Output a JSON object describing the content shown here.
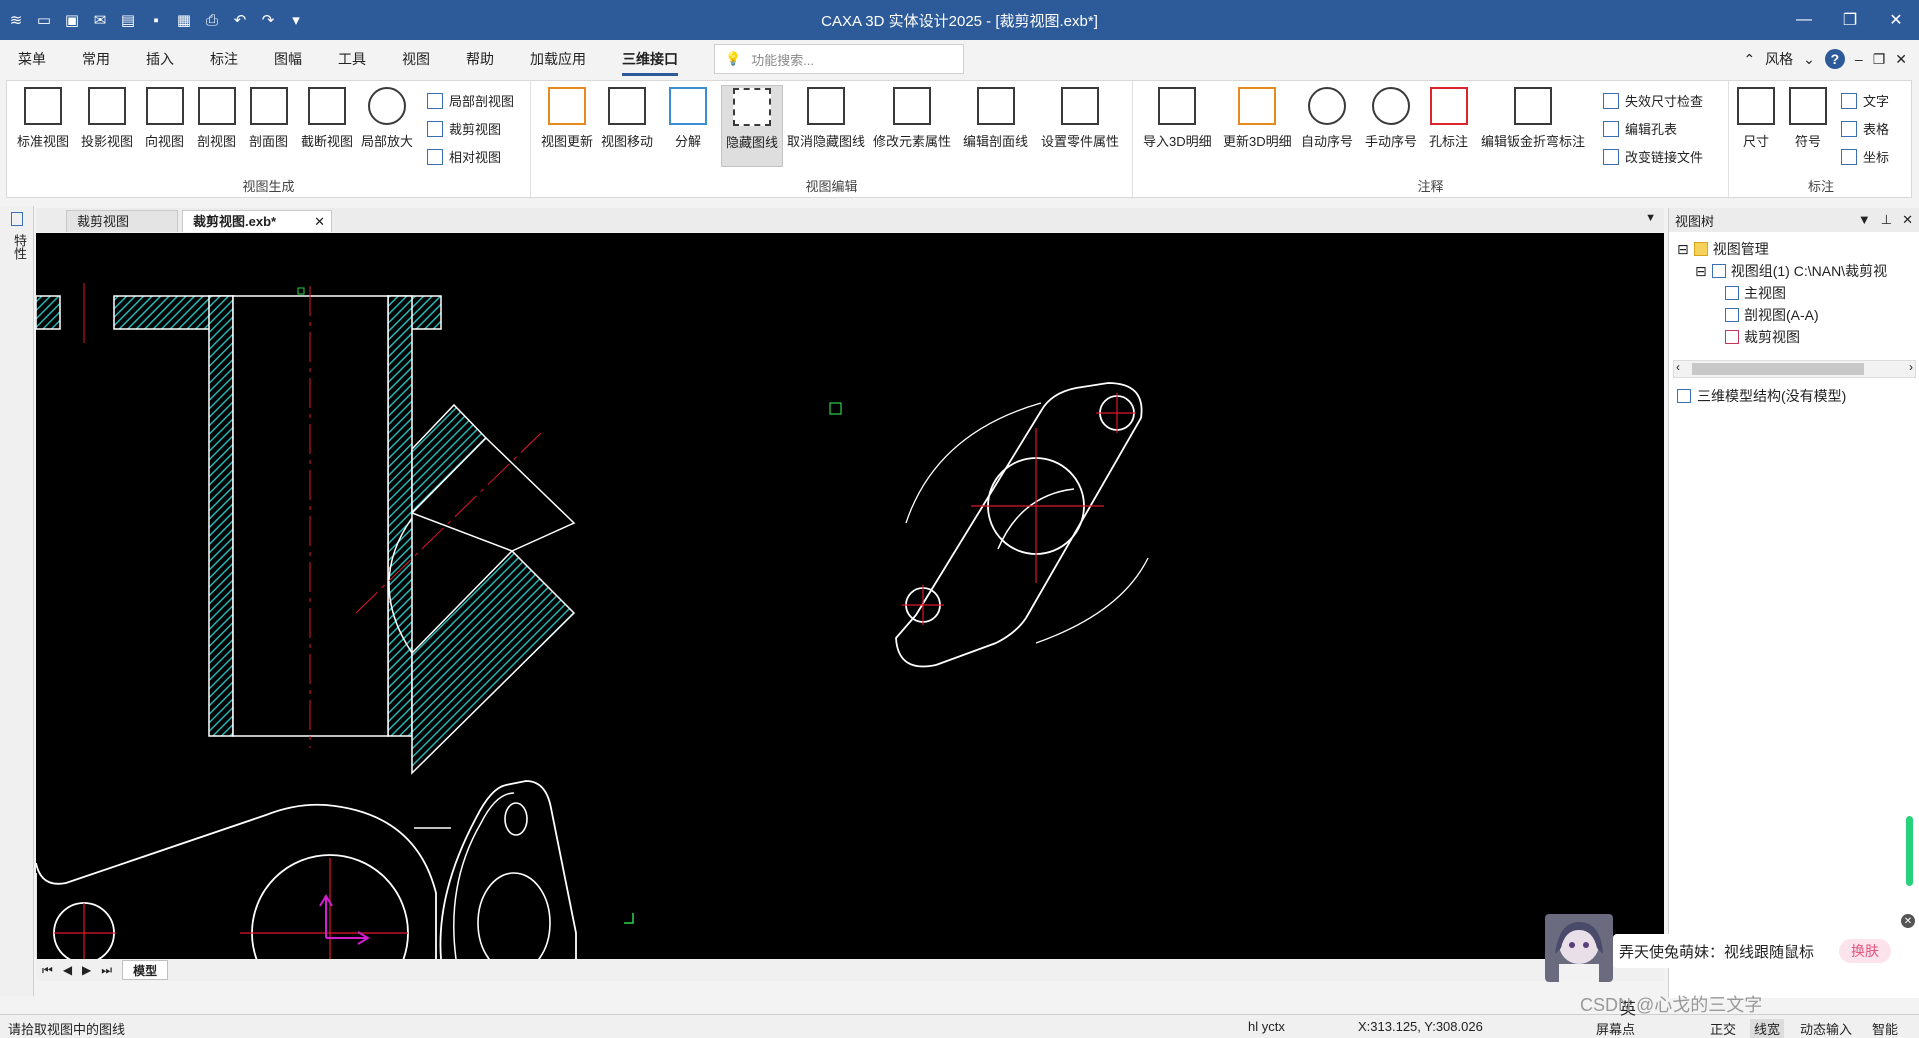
{
  "window": {
    "title": "CAXA 3D 实体设计2025 - [裁剪视图.exb*]",
    "quick_access_icons": [
      "app-logo-icon",
      "new-file-icon",
      "open-template-icon",
      "mail-icon",
      "open-folder-icon",
      "save-icon",
      "save-as-icon",
      "print-icon",
      "undo-icon",
      "redo-icon",
      "customize-icon"
    ]
  },
  "menu": {
    "items": [
      "菜单",
      "常用",
      "插入",
      "标注",
      "图幅",
      "工具",
      "视图",
      "帮助",
      "加载应用",
      "三维接口"
    ],
    "active": "三维接口",
    "search_placeholder": "功能搜索...",
    "style_label": "风格"
  },
  "ribbon": {
    "groups": [
      {
        "label": "视图生成",
        "buttons": [
          "标准视图",
          "投影视图",
          "向视图",
          "剖视图",
          "剖面图",
          "截断视图",
          "局部放大"
        ],
        "small_buttons": [
          "局部剖视图",
          "裁剪视图",
          "相对视图"
        ]
      },
      {
        "label": "视图编辑",
        "buttons": [
          "视图更新",
          "视图移动",
          "分解",
          "隐藏图线",
          "取消隐藏图线",
          "修改元素属性",
          "编辑剖面线",
          "设置零件属性"
        ],
        "selected": "隐藏图线"
      },
      {
        "label": "注释",
        "buttons": [
          "导入3D明细",
          "更新3D明细",
          "自动序号",
          "手动序号",
          "孔标注",
          "编辑钣金折弯标注"
        ],
        "small_buttons": [
          "失效尺寸检查",
          "编辑孔表",
          "改变链接文件"
        ]
      },
      {
        "label": "标注",
        "buttons": [
          "尺寸",
          "符号"
        ],
        "small_buttons": [
          "文字",
          "表格",
          "坐标"
        ]
      }
    ]
  },
  "left_strip": {
    "label": "特性"
  },
  "doc_tabs": [
    {
      "label": "裁剪视图",
      "active": false
    },
    {
      "label": "裁剪视图.exb*",
      "active": true
    }
  ],
  "sheet_tabs": {
    "model_label": "模型"
  },
  "view_tree": {
    "title": "视图树",
    "nodes": [
      {
        "label": "视图管理",
        "level": 0
      },
      {
        "label": "视图组(1)  C:\\NAN\\裁剪视",
        "level": 1
      },
      {
        "label": "主视图",
        "level": 2
      },
      {
        "label": "剖视图(A-A)",
        "level": 2
      },
      {
        "label": "裁剪视图",
        "level": 2
      }
    ],
    "structure_label": "三维模型结构(没有模型)"
  },
  "status": {
    "prompt": "请拾取视图中的图线",
    "command": "hl yctx",
    "coords": "X:313.125, Y:308.026",
    "modes": [
      "屏幕点",
      "正交",
      "线宽",
      "动态输入",
      "智能"
    ]
  },
  "floating_widget": {
    "message": "弄天使兔萌妹：视线跟随鼠标",
    "swap_label": "换肤",
    "toolbar_labels": [
      "英",
      "CSDN @心戈的三文字"
    ]
  },
  "colors": {
    "titlebar": "#2d5b9a",
    "canvas_bg": "#000000",
    "hatch": "#25b5b5",
    "centerline": "#e0162b",
    "outline": "#ffffff"
  }
}
